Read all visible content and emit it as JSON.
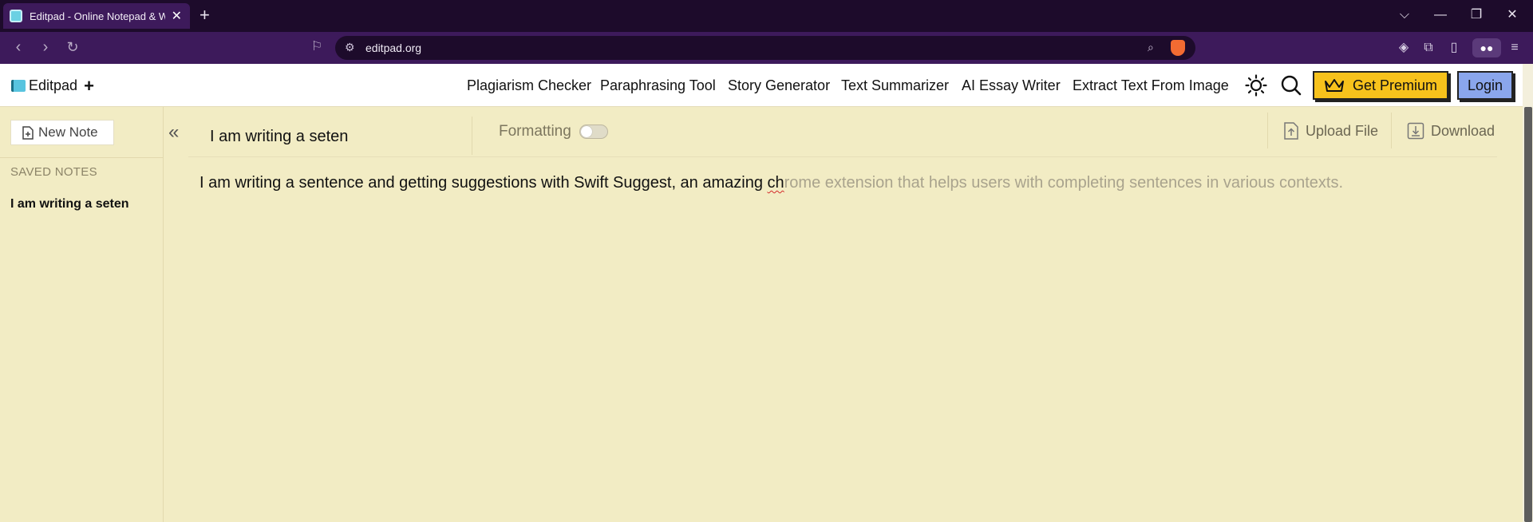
{
  "browser": {
    "tab_title": "Editpad - Online Notepad & Wo",
    "new_tab": "+",
    "tab_close": "✕",
    "url": "editpad.org",
    "window_controls": [
      "⌵",
      "—",
      "❐",
      "✕"
    ]
  },
  "site": {
    "logo_text": "Editpad",
    "logo_plus": "+",
    "nav": [
      "Plagiarism Checker",
      "Paraphrasing Tool",
      "Story Generator",
      "Text Summarizer",
      "AI Essay Writer",
      "Extract Text From Image"
    ],
    "premium_label": "Get Premium",
    "login_label": "Login"
  },
  "sidebar": {
    "new_note_label": "New Note",
    "saved_notes_label": "SAVED NOTES",
    "saved_notes": [
      "I am writing a seten"
    ],
    "collapse_icon": "«"
  },
  "editor": {
    "title": "I am writing a seten",
    "formatting_label": "Formatting",
    "formatting_enabled": false,
    "upload_label": "Upload File",
    "download_label": "Download",
    "typed_text": "I am writing a sentence and getting suggestions with Swift Suggest, an amazing ",
    "typed_misspelled": "ch",
    "suggestion_text": "rome extension that helps users with completing sentences in various contexts."
  },
  "colors": {
    "page_bg": "#f2ecc4",
    "browser_tab_bg": "#1d0b2b",
    "browser_toolbar_bg": "#3d1a5b",
    "premium_bg": "#f7c21c",
    "login_bg": "#8aa6ec",
    "suggestion_text": "#a9a38d"
  },
  "icons": {
    "logo": "book-icon",
    "theme": "sun-icon",
    "search": "search-icon",
    "premium": "crown-icon",
    "new_note": "file-plus-icon",
    "upload": "file-upload-icon",
    "download": "file-download-icon"
  }
}
